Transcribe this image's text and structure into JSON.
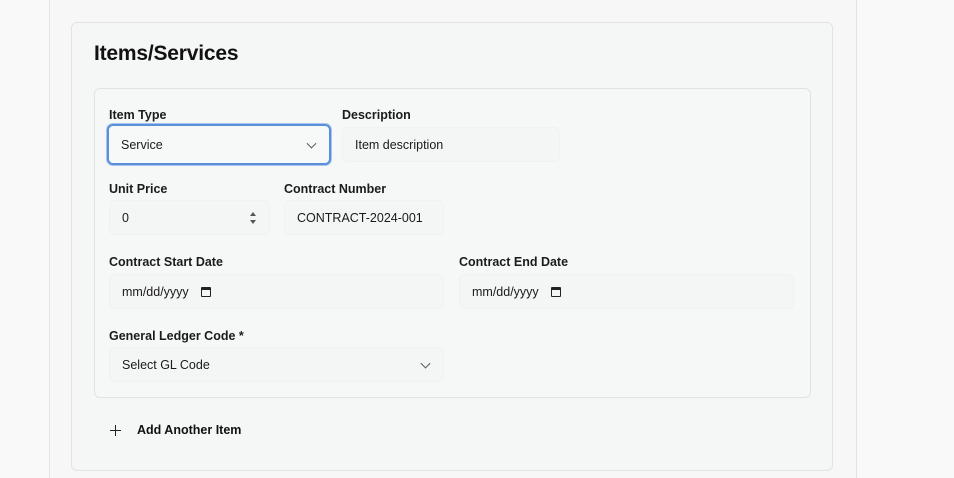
{
  "section": {
    "title": "Items/Services"
  },
  "item": {
    "item_type": {
      "label": "Item Type",
      "value": "Service"
    },
    "description": {
      "label": "Description",
      "value": "Item description"
    },
    "unit_price": {
      "label": "Unit Price",
      "value": "0"
    },
    "contract_number": {
      "label": "Contract Number",
      "value": "CONTRACT-2024-001"
    },
    "contract_start_date": {
      "label": "Contract Start Date",
      "value": "mm/dd/yyyy"
    },
    "contract_end_date": {
      "label": "Contract End Date",
      "value": "mm/dd/yyyy"
    },
    "gl_code": {
      "label": "General Ledger Code *",
      "value": "Select GL Code"
    }
  },
  "add_item_button": {
    "label": "Add Another Item"
  },
  "icons": {
    "select_chevron": "chevron-down-icon",
    "calendar": "calendar-icon",
    "number_spinner": "spinner-icon",
    "add": "plus-icon"
  },
  "colors": {
    "focus_ring": "#5b8fd9"
  }
}
